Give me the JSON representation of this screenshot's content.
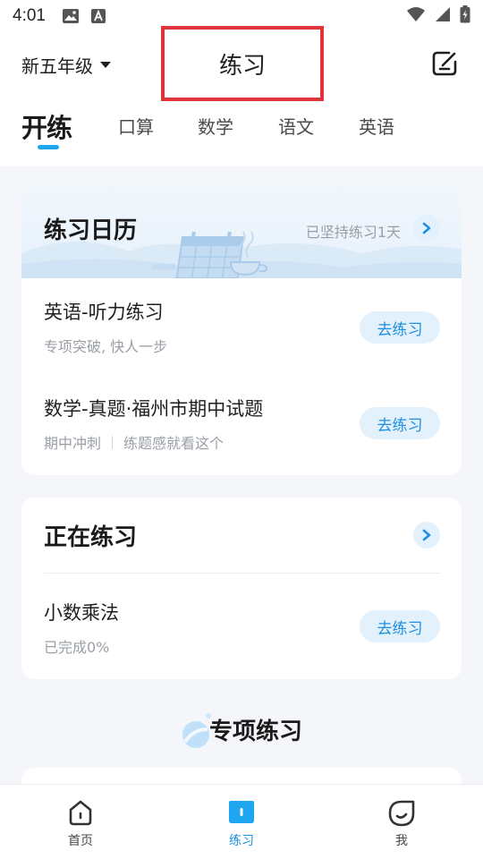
{
  "status_bar": {
    "time": "4:01"
  },
  "header": {
    "grade": "新五年级",
    "title": "练习",
    "edit_icon": "edit-note-icon"
  },
  "tabs": {
    "brand": "开练",
    "items": [
      "口算",
      "数学",
      "语文",
      "英语"
    ],
    "active": "开练"
  },
  "calendar": {
    "title": "练习日历",
    "streak": "已坚持练习1天",
    "items": [
      {
        "title": "英语-听力练习",
        "sub": [
          "专项突破, 快人一步"
        ],
        "button": "去练习"
      },
      {
        "title": "数学-真题·福州市期中试题",
        "sub": [
          "期中冲刺",
          "练题感就看这个"
        ],
        "button": "去练习"
      }
    ]
  },
  "in_progress": {
    "title": "正在练习",
    "item": {
      "title": "小数乘法",
      "sub": "已完成0%",
      "button": "去练习",
      "progress": 0
    }
  },
  "special": {
    "title": "专项练习"
  },
  "bottom_nav": {
    "items": [
      {
        "label": "首页",
        "icon": "home-icon"
      },
      {
        "label": "练习",
        "icon": "book-icon"
      },
      {
        "label": "我",
        "icon": "profile-leaf-icon"
      }
    ],
    "active": "练习"
  },
  "colors": {
    "accent": "#1e8fe0",
    "highlight_box": "#e0333a",
    "button_bg": "#e3f1fc"
  }
}
